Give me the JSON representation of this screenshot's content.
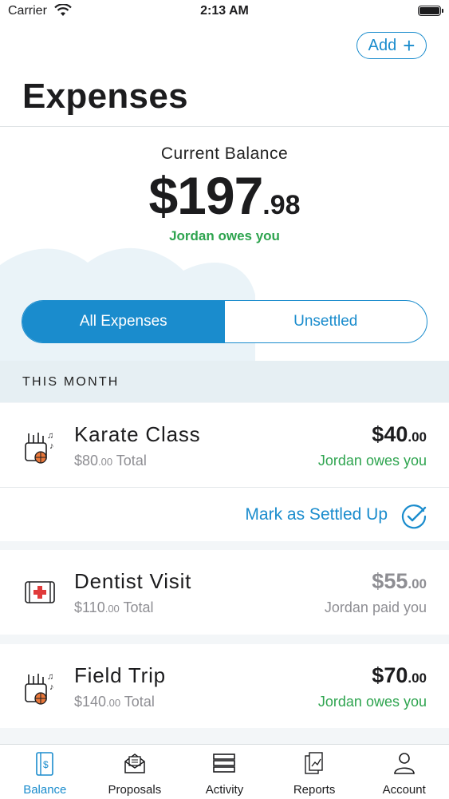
{
  "status_bar": {
    "carrier": "Carrier",
    "time": "2:13 AM"
  },
  "header": {
    "add_label": "Add",
    "title": "Expenses"
  },
  "balance": {
    "label": "Current Balance",
    "dollars": "$197",
    "cents": ".98",
    "note": "Jordan owes you"
  },
  "filter": {
    "options": [
      "All Expenses",
      "Unsettled"
    ],
    "selected": "All Expenses"
  },
  "section": {
    "label": "THIS MONTH"
  },
  "expenses": [
    {
      "title": "Karate Class",
      "total": "$80",
      "total_cents": ".00",
      "total_suffix": " Total",
      "amount": "$40",
      "amount_cents": ".00",
      "status": "Jordan owes you",
      "status_color": "#2ea44f",
      "icon": "activities-icon"
    },
    {
      "title": "Dentist Visit",
      "total": "$110",
      "total_cents": ".00",
      "total_suffix": " Total",
      "amount": "$55",
      "amount_cents": ".00",
      "status": "Jordan paid you",
      "status_color": "#8e8e93",
      "icon": "medical-kit-icon"
    },
    {
      "title": "Field Trip",
      "total": "$140",
      "total_cents": ".00",
      "total_suffix": " Total",
      "amount": "$70",
      "amount_cents": ".00",
      "status": "Jordan owes you",
      "status_color": "#2ea44f",
      "icon": "activities-icon"
    }
  ],
  "settle_action": {
    "label": "Mark as Settled Up"
  },
  "tabs": [
    {
      "label": "Balance",
      "icon": "balance-book-icon",
      "active": true
    },
    {
      "label": "Proposals",
      "icon": "envelope-icon",
      "active": false
    },
    {
      "label": "Activity",
      "icon": "list-icon",
      "active": false
    },
    {
      "label": "Reports",
      "icon": "report-icon",
      "active": false
    },
    {
      "label": "Account",
      "icon": "person-icon",
      "active": false
    }
  ],
  "colors": {
    "accent": "#1a8ccd",
    "positive": "#2ea44f",
    "muted": "#8e8e93"
  }
}
